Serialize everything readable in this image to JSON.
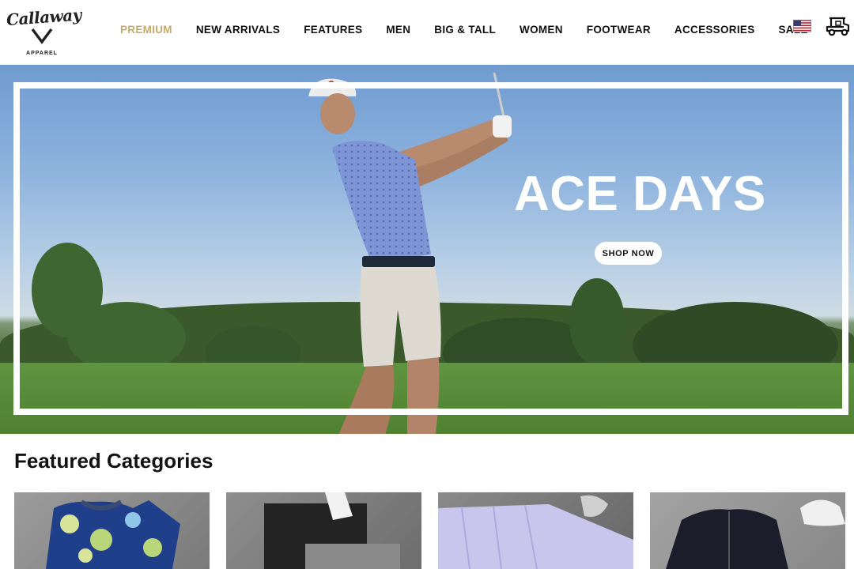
{
  "brand": {
    "logo_word": "Callaway",
    "logo_sub": "APPAREL"
  },
  "nav": {
    "items": [
      {
        "label": "PREMIUM",
        "accent": "#c8a96a"
      },
      {
        "label": "NEW ARRIVALS"
      },
      {
        "label": "FEATURES"
      },
      {
        "label": "MEN"
      },
      {
        "label": "BIG & TALL"
      },
      {
        "label": "WOMEN"
      },
      {
        "label": "FOOTWEAR"
      },
      {
        "label": "ACCESSORIES"
      },
      {
        "label": "SALE"
      }
    ],
    "icons": [
      "us-flag-icon",
      "golf-cart-icon"
    ]
  },
  "hero": {
    "title": "ACE DAYS",
    "cta_label": "SHOP NOW"
  },
  "featured": {
    "title": "Featured Categories",
    "cards": [
      "polo-shirts-card",
      "pants-card",
      "skirts-card",
      "outerwear-card"
    ]
  }
}
